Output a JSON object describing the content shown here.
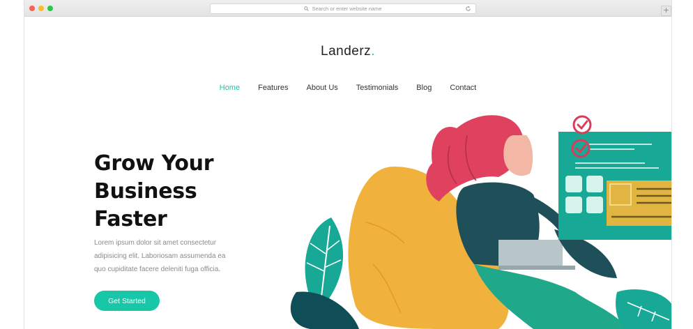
{
  "browser": {
    "address_placeholder": "Search or enter website name",
    "new_tab_label": "+"
  },
  "site": {
    "logo_text": "Landerz",
    "logo_dot": ".",
    "nav": [
      {
        "label": "Home",
        "active": true
      },
      {
        "label": "Features",
        "active": false
      },
      {
        "label": "About Us",
        "active": false
      },
      {
        "label": "Testimonials",
        "active": false
      },
      {
        "label": "Blog",
        "active": false
      },
      {
        "label": "Contact",
        "active": false
      }
    ],
    "hero": {
      "title_lines": [
        "Grow Your",
        "Business",
        "Faster"
      ],
      "description_lines": [
        "Lorem ipsum dolor sit amet consectetur",
        "adipisicing elit. Laboriosam assumenda ea",
        "quo cupiditate facere deleniti fuga officia."
      ],
      "cta_label": "Get Started"
    }
  },
  "colors": {
    "accent": "#17c7a7",
    "panel": "#17a896",
    "hair": "#e0415f",
    "beanbag": "#f0b13d",
    "sweater": "#1f4f58",
    "leaf_dark": "#0f4d57",
    "pants": "#1fa88a"
  },
  "icons": [
    "search-icon",
    "reload-icon",
    "checkmark-icon"
  ]
}
